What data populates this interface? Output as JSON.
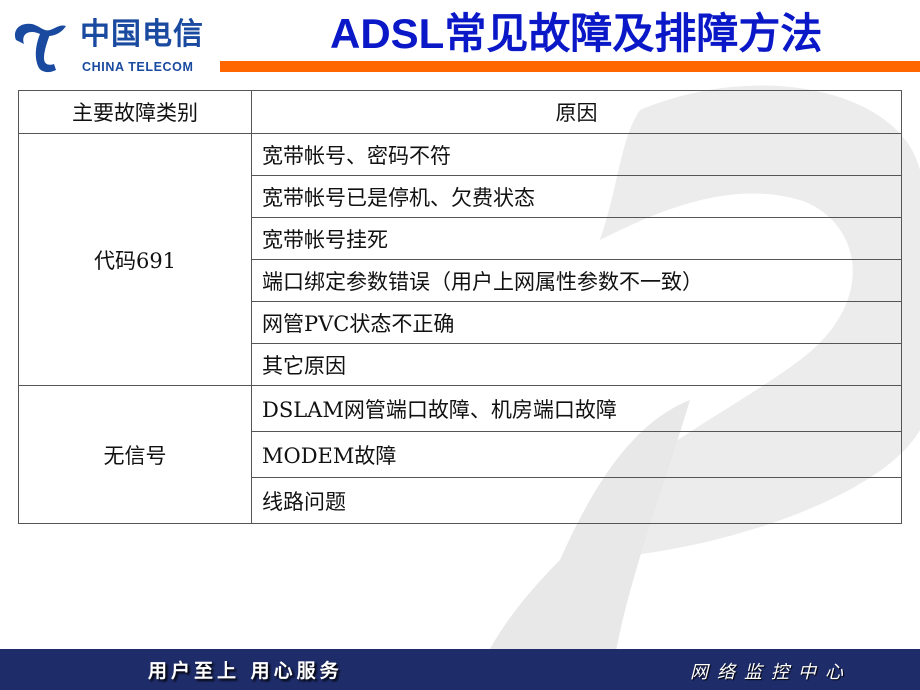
{
  "header": {
    "logo_cn": "中国电信",
    "logo_en": "CHINA TELECOM",
    "title": "ADSL常见故障及排障方法"
  },
  "colors": {
    "title": "#0a18c8",
    "brand_blue": "#1a4aa0",
    "accent_orange": "#ff6600",
    "footer_bg": "#1e2c6a"
  },
  "table": {
    "headers": [
      "主要故障类别",
      "原因"
    ],
    "groups": [
      {
        "category": "代码691",
        "reasons": [
          "宽带帐号、密码不符",
          "宽带帐号已是停机、欠费状态",
          "宽带帐号挂死",
          "端口绑定参数错误（用户上网属性参数不一致）",
          "网管PVC状态不正确",
          "其它原因"
        ]
      },
      {
        "category": "无信号",
        "reasons": [
          "DSLAM网管端口故障、机房端口故障",
          "MODEM故障",
          "线路问题"
        ]
      }
    ]
  },
  "footer": {
    "slogan": "用户至上 用心服务",
    "department": "网络监控中心"
  }
}
